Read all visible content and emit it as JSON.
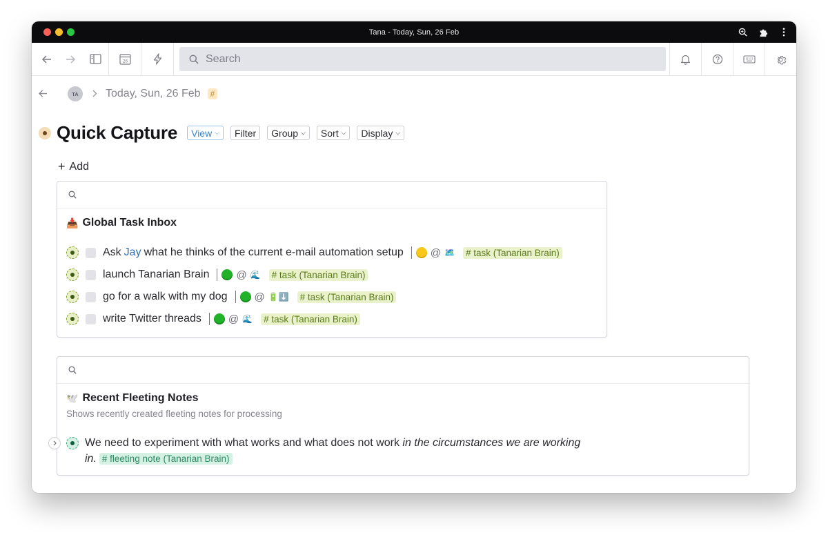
{
  "window": {
    "title": "Tana - Today, Sun, 26 Feb"
  },
  "toolbar": {
    "calendar_day": "26",
    "search_placeholder": "Search"
  },
  "breadcrumb": {
    "avatar_initials": "TA",
    "date": "Today, Sun, 26 Feb",
    "tag": "#"
  },
  "page": {
    "title": "Quick Capture",
    "view_buttons": [
      {
        "label": "View"
      },
      {
        "label": "Filter"
      },
      {
        "label": "Group"
      },
      {
        "label": "Sort"
      },
      {
        "label": "Display"
      }
    ],
    "add_label": "Add"
  },
  "task_inbox": {
    "emoji": "📥",
    "title": "Global Task Inbox",
    "tasks": [
      {
        "before": "Ask",
        "link": "Jay",
        "after": "what he thinks of the current e-mail automation setup",
        "status": "yellow",
        "context": "🗺️",
        "tag": "# task (Tanarian Brain)"
      },
      {
        "before": "launch Tanarian Brain",
        "link": "",
        "after": "",
        "status": "green",
        "context": "🌊",
        "tag": "# task (Tanarian Brain)"
      },
      {
        "before": "go for a walk with my dog",
        "link": "",
        "after": "",
        "status": "green",
        "context": "🔋⬇️",
        "tag": "# task (Tanarian Brain)"
      },
      {
        "before": "write Twitter threads",
        "link": "",
        "after": "",
        "status": "green",
        "context": "🌊",
        "tag": "# task (Tanarian Brain)"
      }
    ]
  },
  "fleeting": {
    "emoji": "🕊️",
    "title": "Recent Fleeting Notes",
    "subtitle": "Shows recently created fleeting notes for processing",
    "note": {
      "text_plain": "We need to experiment with what works and what does not work ",
      "text_italic": "in the circumstances we are working in.",
      "tag": "# fleeting note (Tanarian Brain)"
    }
  }
}
